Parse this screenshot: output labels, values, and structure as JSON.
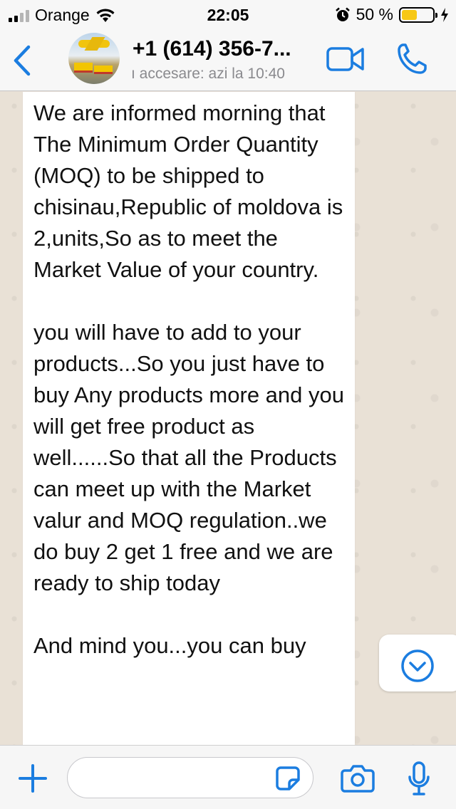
{
  "status_bar": {
    "carrier": "Orange",
    "time": "22:05",
    "battery_percent": "50 %",
    "battery_level": 0.5,
    "icons": [
      "signal-icon",
      "wifi-icon",
      "alarm-icon",
      "battery-icon",
      "charging-icon"
    ]
  },
  "header": {
    "contact_name": "+1 (614) 356-7...",
    "last_seen": "ı accesare: azi la 10:40",
    "icons": [
      "back-chevron-icon",
      "video-call-icon",
      "phone-call-icon"
    ],
    "accent_color": "#1b7de0"
  },
  "message": {
    "paragraphs": [
      "We are informed morning that The Minimum Order Quantity (MOQ) to be shipped to chisinau,Republic of moldova is 2,units,So as to meet the Market Value of your country.",
      "you will have to add to your products...So you just have to buy Any products more and you will get free product as well......So that all the Products can meet up with the Market valur and MOQ regulation..we do buy 2 get 1 free and we are ready to ship today",
      "And mind you...you can buy"
    ]
  },
  "scroll_button": {
    "icon": "chevron-down-circle-icon"
  },
  "input_bar": {
    "placeholder": "",
    "icons": [
      "plus-icon",
      "sticker-icon",
      "camera-icon",
      "microphone-icon"
    ]
  }
}
